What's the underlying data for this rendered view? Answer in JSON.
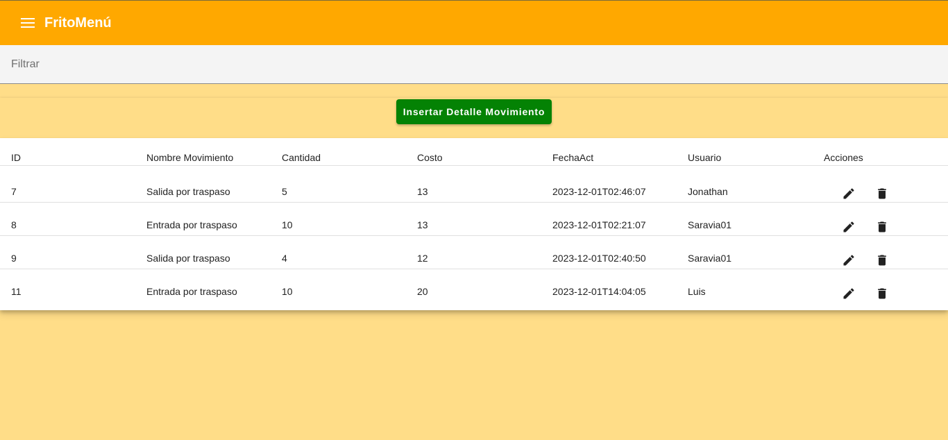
{
  "app": {
    "title": "FritoMenú"
  },
  "filter": {
    "placeholder": "Filtrar",
    "value": ""
  },
  "actions": {
    "insert_label": "Insertar Detalle Movimiento"
  },
  "colors": {
    "toolbar": "#ffa800",
    "background": "#ffdd88",
    "insert_button": "#048204"
  },
  "table": {
    "headers": [
      "ID",
      "Nombre Movimiento",
      "Cantidad",
      "Costo",
      "FechaAct",
      "Usuario",
      "Acciones"
    ],
    "rows": [
      {
        "id": "7",
        "nombre": "Salida por traspaso",
        "cantidad": "5",
        "costo": "13",
        "fecha": "2023-12-01T02:46:07",
        "usuario": "Jonathan"
      },
      {
        "id": "8",
        "nombre": "Entrada por traspaso",
        "cantidad": "10",
        "costo": "13",
        "fecha": "2023-12-01T02:21:07",
        "usuario": "Saravia01"
      },
      {
        "id": "9",
        "nombre": "Salida por traspaso",
        "cantidad": "4",
        "costo": "12",
        "fecha": "2023-12-01T02:40:50",
        "usuario": "Saravia01"
      },
      {
        "id": "11",
        "nombre": "Entrada por traspaso",
        "cantidad": "10",
        "costo": "20",
        "fecha": "2023-12-01T14:04:05",
        "usuario": "Luis"
      }
    ],
    "row_icons": [
      "edit-icon",
      "delete-icon"
    ]
  }
}
